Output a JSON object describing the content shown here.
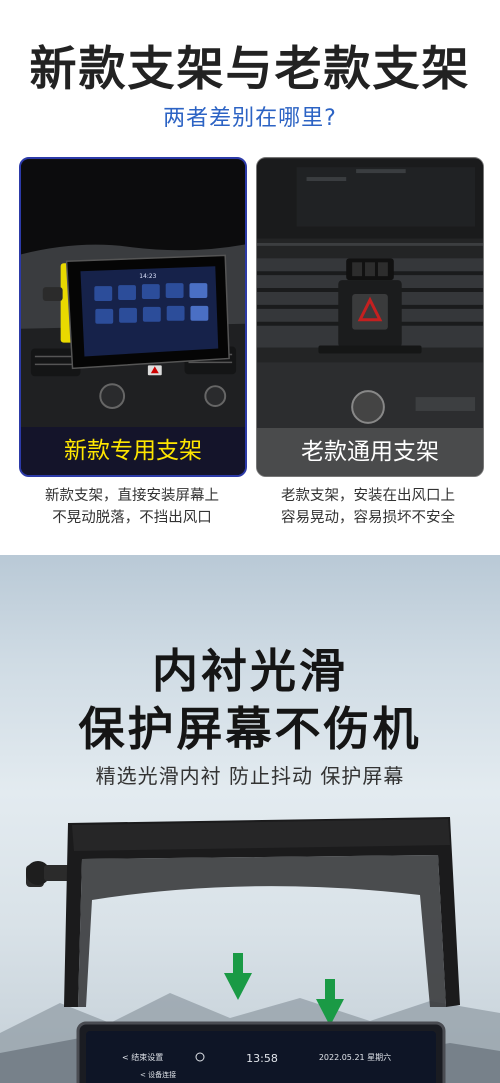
{
  "section1": {
    "title": "新款支架与老款支架",
    "subtitle": "两者差别在哪里?",
    "new_card": {
      "label": "新款专用支架",
      "screen_time": "14:23",
      "desc_line1": "新款支架，直接安装屏幕上",
      "desc_line2": "不晃动脱落，不挡出风口"
    },
    "old_card": {
      "label": "老款通用支架",
      "desc_line1": "老款支架，安装在出风口上",
      "desc_line2": "容易晃动，容易损坏不安全"
    }
  },
  "section2": {
    "title_line1": "内衬光滑",
    "title_line2": "保护屏幕不伤机",
    "tagline": "精选光滑内衬 防止抖动 保护屏幕",
    "screen": {
      "left_label": "< 结束设置",
      "time": "13:58",
      "date": "2022.05.21 星期六",
      "bottom_label": "< 设备连接"
    }
  },
  "colors": {
    "title": "#222222",
    "subtitle": "#2c63c4",
    "new_label": "#ffe600",
    "new_border": "#2c3aa8",
    "old_label": "#ffffff",
    "arrow": "#1a9a45"
  }
}
